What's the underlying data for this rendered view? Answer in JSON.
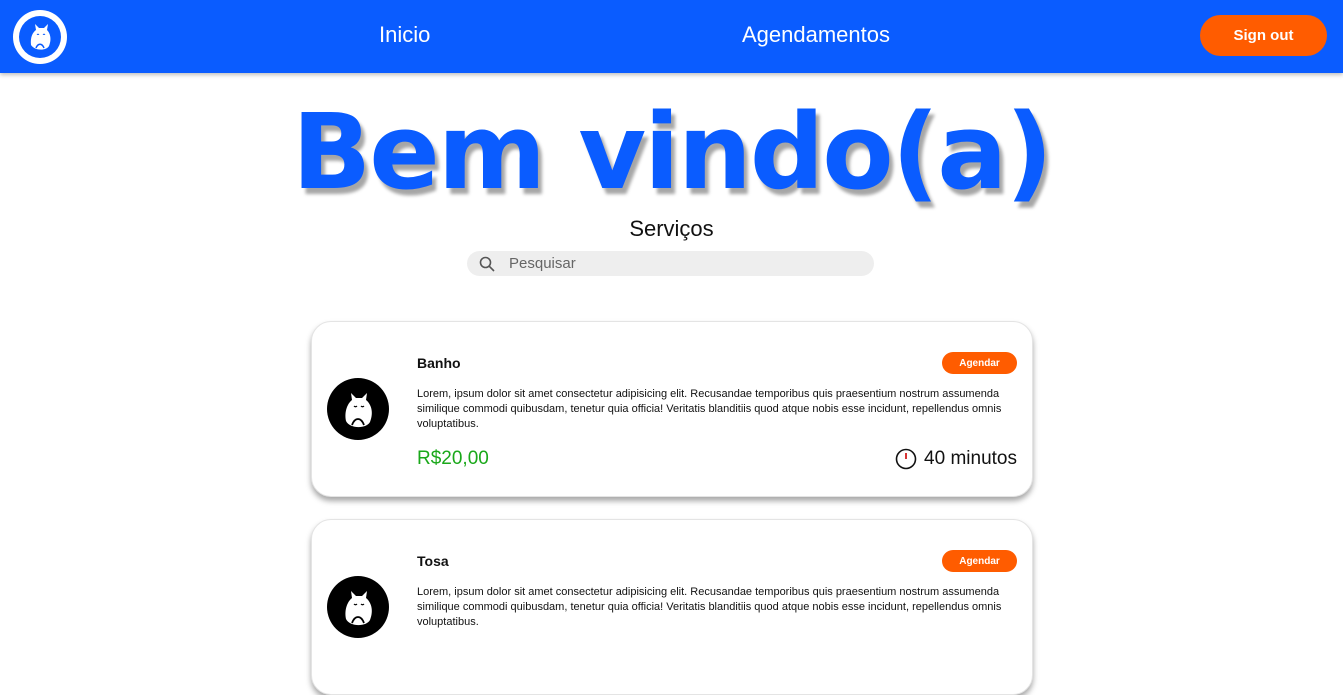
{
  "nav": {
    "logo_icon": "cat-logo-icon",
    "links": [
      {
        "label": "Inicio"
      },
      {
        "label": "Agendamentos"
      }
    ],
    "signout_label": "Sign out"
  },
  "hero": {
    "title": "Bem vindo(a)"
  },
  "services": {
    "title": "Serviços",
    "search_placeholder": "Pesquisar",
    "items": [
      {
        "name": "Banho",
        "button_label": "Agendar",
        "description": "Lorem, ipsum dolor sit amet consectetur adipisicing elit. Recusandae temporibus quis praesentium nostrum assumenda similique commodi quibusdam, tenetur quia officia! Veritatis blanditiis quod atque nobis esse incidunt, repellendus omnis voluptatibus.",
        "price": "R$20,00",
        "duration": "40 minutos"
      },
      {
        "name": "Tosa",
        "button_label": "Agendar",
        "description": "Lorem, ipsum dolor sit amet consectetur adipisicing elit. Recusandae temporibus quis praesentium nostrum assumenda similique commodi quibusdam, tenetur quia officia! Veritatis blanditiis quod atque nobis esse incidunt, repellendus omnis voluptatibus.",
        "price": "",
        "duration": ""
      }
    ]
  },
  "colors": {
    "brand_blue": "#0a5cff",
    "accent_orange": "#ff5c00",
    "price_green": "#1aa81a"
  }
}
